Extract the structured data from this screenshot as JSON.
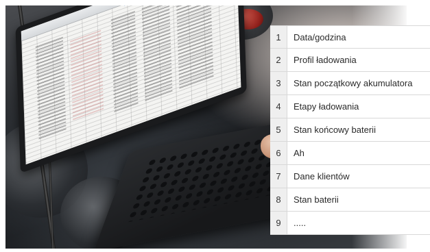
{
  "list": {
    "items": [
      {
        "num": "1",
        "label": "Data/godzina"
      },
      {
        "num": "2",
        "label": "Profil ładowania"
      },
      {
        "num": "3",
        "label": "Stan początkowy akumulatora"
      },
      {
        "num": "4",
        "label": "Etapy ładowania"
      },
      {
        "num": "5",
        "label": "Stan końcowy baterii"
      },
      {
        "num": "6",
        "label": "Ah"
      },
      {
        "num": "7",
        "label": "Dane klientów"
      },
      {
        "num": "8",
        "label": "Stan baterii"
      },
      {
        "num": "9",
        "label": "....."
      }
    ]
  },
  "colors": {
    "number_cell_bg": "#efefef",
    "row_border": "#d8d8d8",
    "text": "#2a2a2a",
    "spreadsheet_accent": "#4a86c5"
  }
}
